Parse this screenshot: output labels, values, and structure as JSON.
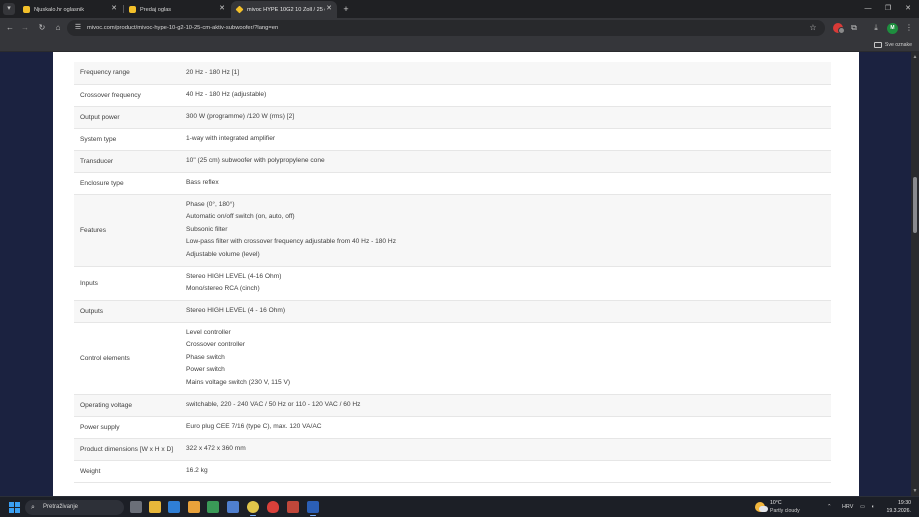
{
  "browser": {
    "tabs": [
      {
        "title": "Njuskalo.hr oglasnik",
        "icon": "njuskalo-favicon",
        "active": false
      },
      {
        "title": "Predaj oglas",
        "icon": "njuskalo-favicon",
        "active": false
      },
      {
        "title": "mivoc HYPE 10G2 10 Zoll / 25 c",
        "icon": "mivoc-favicon",
        "active": true
      }
    ],
    "new_tab_label": "+",
    "url": "mivoc.com/product/mivoc-hype-10-g2-10-25-cm-aktiv-subwoofer/?lang=en",
    "bookmarks_all_label": "Sve oznake",
    "profile_initial": "M",
    "window_controls": {
      "minimize": "—",
      "restore": "❐",
      "close": "✕"
    }
  },
  "specs": [
    {
      "label": "Frequency range",
      "values": [
        "20 Hz - 180 Hz [1]"
      ]
    },
    {
      "label": "Crossover frequency",
      "values": [
        "40 Hz - 180 Hz (adjustable)"
      ]
    },
    {
      "label": "Output power",
      "values": [
        "300 W (programme) /120 W (rms) [2]"
      ]
    },
    {
      "label": "System type",
      "values": [
        "1-way with integrated amplifier"
      ]
    },
    {
      "label": "Transducer",
      "values": [
        "10\" (25 cm) subwoofer with polypropylene cone"
      ]
    },
    {
      "label": "Enclosure type",
      "values": [
        "Bass reflex"
      ]
    },
    {
      "label": "Features",
      "values": [
        "Phase (0°, 180°)",
        "Automatic on/off switch (on, auto, off)",
        "Subsonic filter",
        "Low-pass filter with crossover frequency adjustable from 40 Hz - 180 Hz",
        "Adjustable volume (level)"
      ]
    },
    {
      "label": "Inputs",
      "values": [
        "Stereo HIGH LEVEL (4-16 Ohm)",
        "Mono/stereo RCA (cinch)"
      ]
    },
    {
      "label": "Outputs",
      "values": [
        "Stereo HIGH LEVEL (4 - 16 Ohm)"
      ]
    },
    {
      "label": "Control elements",
      "values": [
        "Level controller",
        "Crossover controller",
        "Phase switch",
        "Power switch",
        "Mains voltage switch (230 V, 115 V)"
      ]
    },
    {
      "label": "Operating voltage",
      "values": [
        "switchable, 220 - 240 VAC / 50 Hz or 110 - 120 VAC / 60 Hz"
      ]
    },
    {
      "label": "Power supply",
      "values": [
        "Euro plug CEE 7/16 (type C), max. 120 VA/AC"
      ]
    },
    {
      "label": "Product dimensions [W x H x D]",
      "values": [
        "322 x 472 x 360 mm"
      ]
    },
    {
      "label": "Weight",
      "values": [
        "16.2 kg"
      ]
    }
  ],
  "taskbar": {
    "search_placeholder": "Pretraživanje",
    "weather_temp": "10°C",
    "weather_condition": "Partly cloudy",
    "language": "HRV",
    "time": "19:30",
    "date": "19.3.2026."
  },
  "colors": {
    "page_background": "#1b2240",
    "content_background": "#ffffff",
    "browser_chrome": "#35363a"
  }
}
